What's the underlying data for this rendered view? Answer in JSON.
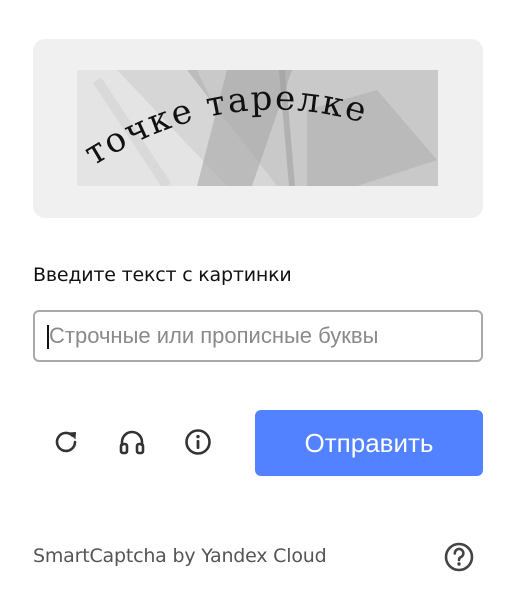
{
  "captcha": {
    "image_text": "точке тарелке"
  },
  "form": {
    "instruction": "Введите текст с картинки",
    "input_value": "",
    "input_placeholder": "Строчные или прописные буквы"
  },
  "actions": {
    "refresh_icon": "refresh-icon",
    "audio_icon": "headphones-icon",
    "info_icon": "info-icon",
    "submit_label": "Отправить"
  },
  "footer": {
    "brand_text": "SmartCaptcha by Yandex Cloud",
    "help_icon": "question-circle-icon"
  },
  "colors": {
    "accent": "#5282ff",
    "panel_bg": "#f0f0f0",
    "icon": "#333333"
  }
}
